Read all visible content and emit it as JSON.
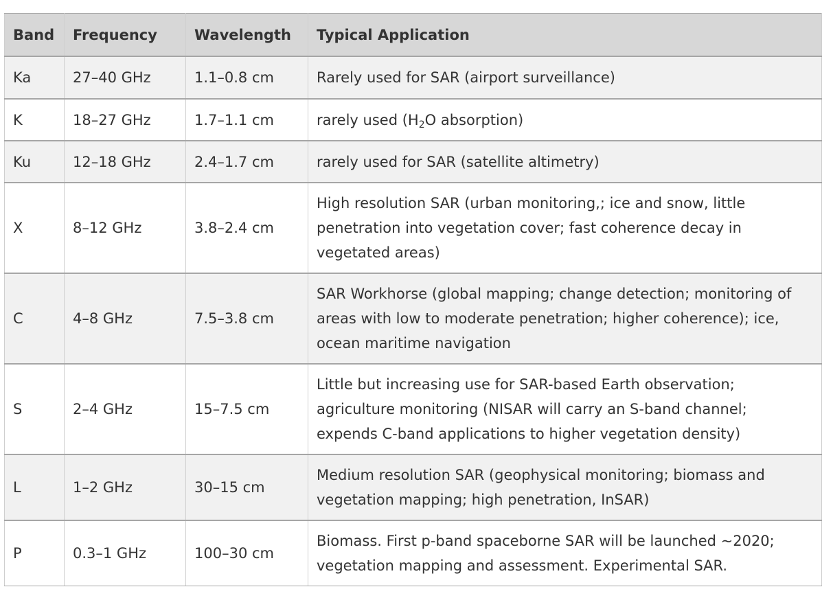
{
  "table": {
    "headers": {
      "band": "Band",
      "frequency": "Frequency",
      "wavelength": "Wavelength",
      "application": "Typical Application"
    },
    "rows": [
      {
        "band": "Ka",
        "frequency": "27–40 GHz",
        "wavelength": "1.1–0.8 cm",
        "application": "Rarely used for SAR (airport surveillance)"
      },
      {
        "band": "K",
        "frequency": "18–27 GHz",
        "wavelength": "1.7–1.1 cm",
        "application_prefix": "rarely used (H",
        "application_subscript": "2",
        "application_suffix": "O absorption)"
      },
      {
        "band": "Ku",
        "frequency": "12–18 GHz",
        "wavelength": "2.4–1.7 cm",
        "application": "rarely used for SAR (satellite altimetry)"
      },
      {
        "band": "X",
        "frequency": "8–12 GHz",
        "wavelength": "3.8–2.4 cm",
        "application": "High resolution SAR (urban monitoring,; ice and snow, little penetration into vegetation cover; fast coherence decay in vegetated areas)"
      },
      {
        "band": "C",
        "frequency": "4–8 GHz",
        "wavelength": "7.5–3.8 cm",
        "application": "SAR Workhorse (global mapping; change detection; monitoring of areas with low to moderate penetration; higher coherence); ice, ocean maritime navigation"
      },
      {
        "band": "S",
        "frequency": "2–4 GHz",
        "wavelength": "15–7.5 cm",
        "application": "Little but increasing use for SAR-based Earth observation; agriculture monitoring (NISAR will carry an S-band channel; expends C-band applications to higher vegetation density)"
      },
      {
        "band": "L",
        "frequency": "1–2 GHz",
        "wavelength": "30–15 cm",
        "application": "Medium resolution SAR (geophysical monitoring; biomass and vegetation mapping; high penetration, InSAR)"
      },
      {
        "band": "P",
        "frequency": "0.3–1 GHz",
        "wavelength": "100–30 cm",
        "application": "Biomass. First p-band spaceborne SAR will be launched ~2020; vegetation mapping and assessment. Experimental SAR."
      }
    ]
  }
}
